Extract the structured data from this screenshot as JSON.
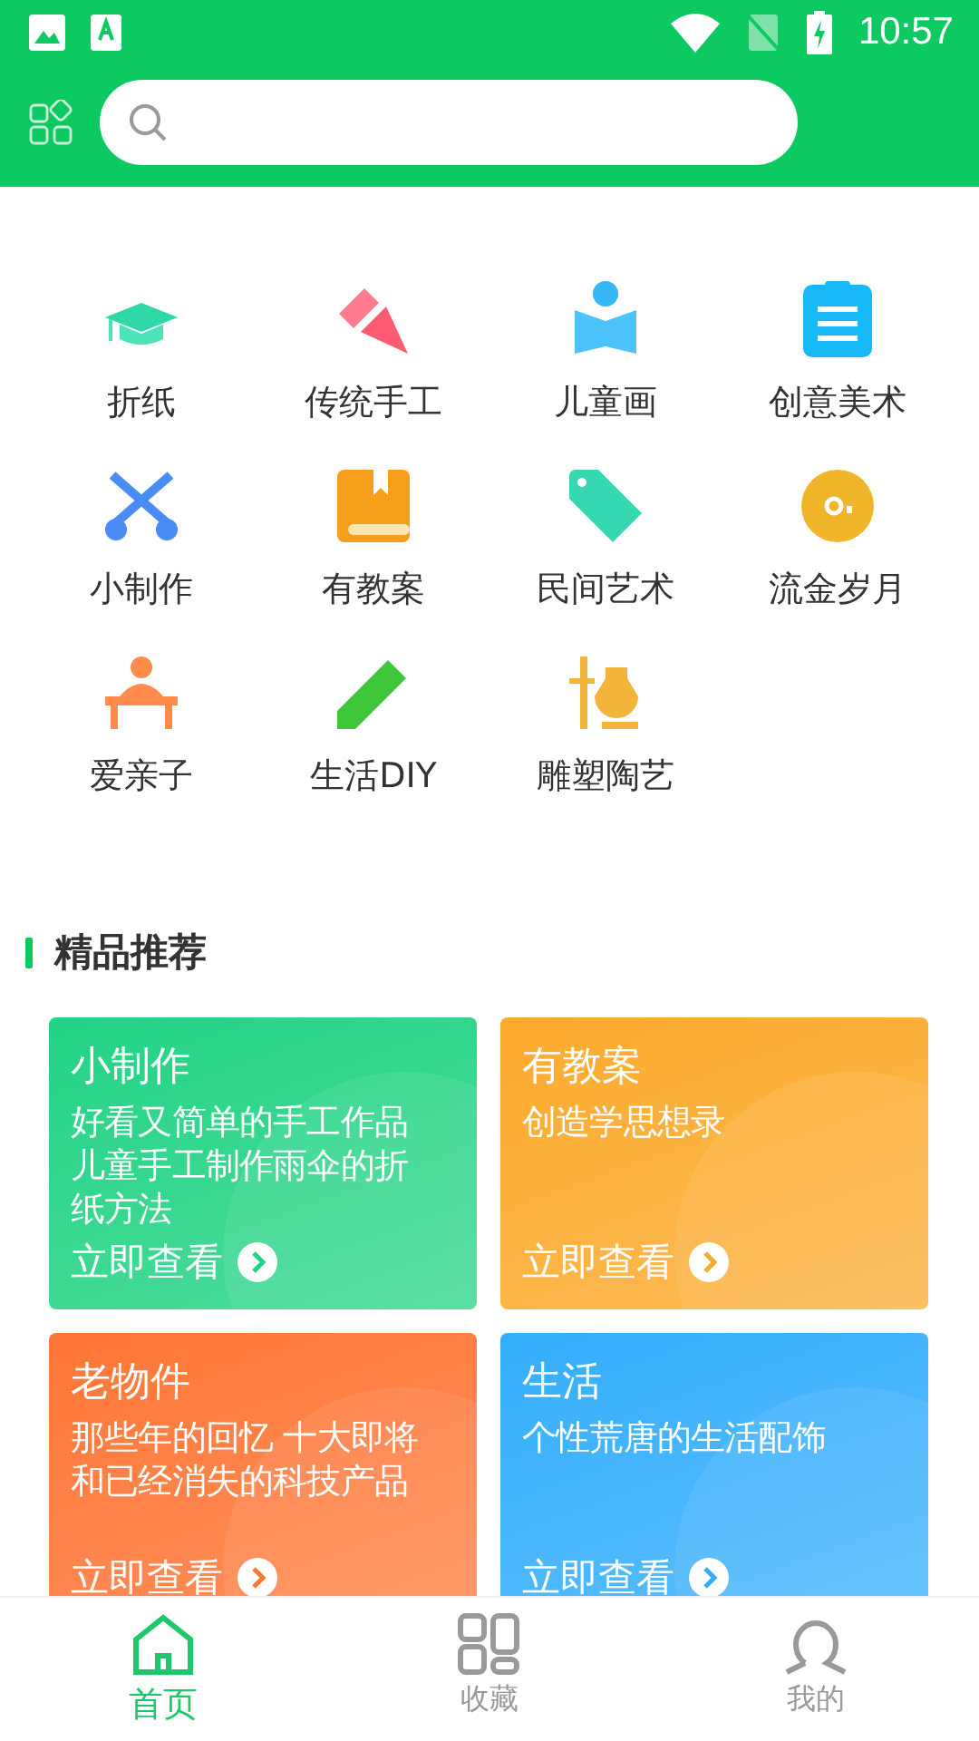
{
  "status_bar": {
    "time": "10:57"
  },
  "categories": [
    {
      "label": "折纸"
    },
    {
      "label": "传统手工"
    },
    {
      "label": "儿童画"
    },
    {
      "label": "创意美术"
    },
    {
      "label": "小制作"
    },
    {
      "label": "有教案"
    },
    {
      "label": "民间艺术"
    },
    {
      "label": "流金岁月"
    },
    {
      "label": "爱亲子"
    },
    {
      "label": "生活DIY"
    },
    {
      "label": "雕塑陶艺"
    }
  ],
  "section": {
    "title": "精品推荐"
  },
  "cards": [
    {
      "title": "小制作",
      "description": [
        "好看又简单的手工作品",
        "儿童手工制作雨伞的折",
        "纸方法"
      ],
      "action": "立即查看",
      "color": "#22d384"
    },
    {
      "title": "有教案",
      "description": [
        "创造学思想录"
      ],
      "action": "立即查看",
      "color": "#fcaa2c"
    },
    {
      "title": "老物件",
      "description": [
        "那些年的回忆 十大即将",
        "和已经消失的科技产品"
      ],
      "action": "立即查看",
      "color": "#ff7636"
    },
    {
      "title": "生活",
      "description": [
        "个性荒唐的生活配饰"
      ],
      "action": "立即查看",
      "color": "#34aefc"
    }
  ],
  "nav": [
    {
      "label": "首页",
      "selected": true
    },
    {
      "label": "收藏",
      "selected": false
    },
    {
      "label": "我的",
      "selected": false
    }
  ]
}
